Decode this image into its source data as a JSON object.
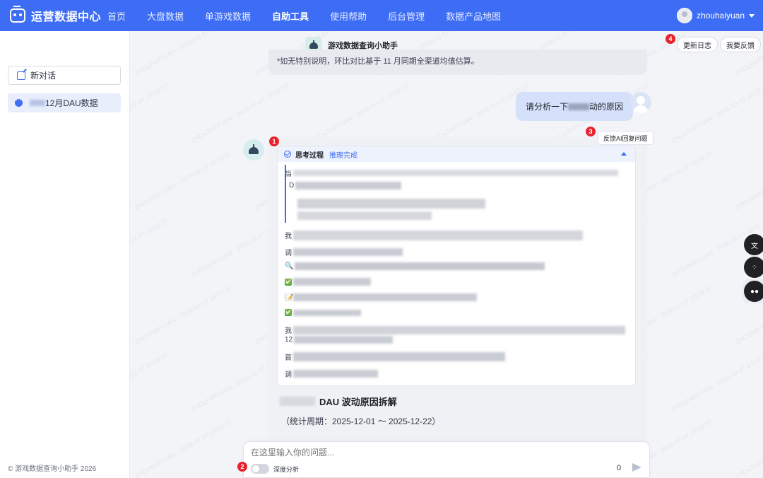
{
  "app": {
    "title": "运营数据中心"
  },
  "nav": [
    {
      "label": "首页",
      "active": false
    },
    {
      "label": "大盘数据",
      "active": false
    },
    {
      "label": "单游戏数据",
      "active": false
    },
    {
      "label": "自助工具",
      "active": true
    },
    {
      "label": "使用帮助",
      "active": false
    },
    {
      "label": "后台管理",
      "active": false
    },
    {
      "label": "数据产品地图",
      "active": false
    }
  ],
  "user": {
    "name": "zhouhaiyuan"
  },
  "sidebar": {
    "new_chat_label": "新对话",
    "conversations": [
      {
        "label": "12月DAU数据"
      }
    ],
    "footer": "© 游戏数据查询小助手 2026"
  },
  "header": {
    "assistant_title": "游戏数据查询小助手",
    "changelog_label": "更新日志",
    "feedback_label": "我要反馈"
  },
  "chat": {
    "prev_message_tail": "*如无特别说明，环比对比基于 11 月同期全渠道均值估算。",
    "user_message_prefix": "请分析一下",
    "user_message_suffix": "动的原因",
    "feedback_ai_label": "反馈AI回复问题",
    "thinking": {
      "label": "思考过程",
      "status": "推理完成",
      "lines": [
        "当",
        "D",
        "我",
        "调",
        "🔍",
        "✅",
        "📝",
        "✅",
        "我",
        "12",
        "首",
        "调"
      ]
    },
    "section_title": "DAU 波动原因拆解",
    "period": "（统计周期：2025-12-01 ～ 2025-12-22）"
  },
  "input": {
    "placeholder": "在这里输入你的问题...",
    "deep_analysis_label": "深度分析",
    "deep_analysis_on": false,
    "char_count": "0"
  },
  "badges": [
    "1",
    "2",
    "3",
    "4"
  ],
  "watermark": "ZHOUHAIYUAN · 2026-02-07 23:02:37",
  "colors": {
    "primary": "#3d6cf5",
    "badge": "#e8232e"
  }
}
